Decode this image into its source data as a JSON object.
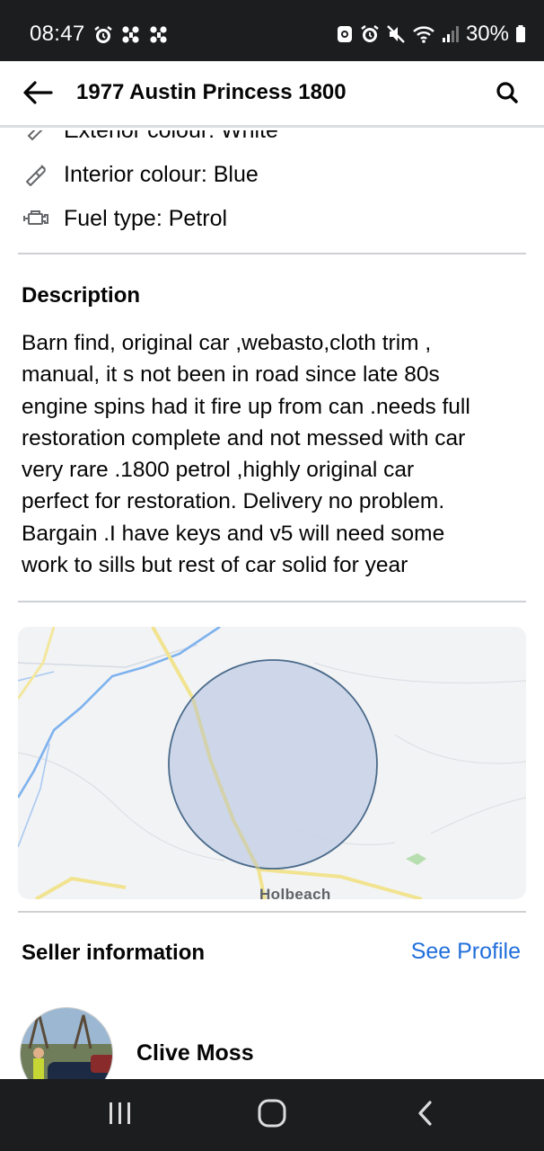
{
  "status_bar": {
    "time": "08:47",
    "battery": "30%",
    "left_icons": [
      "alarm-icon",
      "grid-dots-icon",
      "grid-dots-icon"
    ],
    "right_icons": [
      "lock-icon",
      "alarm-icon",
      "mute-icon",
      "wifi-icon",
      "signal-icon",
      "battery-icon"
    ]
  },
  "header": {
    "title": "1977 Austin Princess 1800"
  },
  "specs": [
    {
      "icon": "paint-icon",
      "label": "Exterior colour: White"
    },
    {
      "icon": "paint-icon",
      "label": "Interior colour: Blue"
    },
    {
      "icon": "engine-icon",
      "label": "Fuel type: Petrol"
    }
  ],
  "description": {
    "heading": "Description",
    "text": "Barn find, original car ,webasto,cloth trim ,\nmanual, it s not been in road since late 80s\nengine spins had it fire up from can .needs full\nrestoration  complete and not messed with car\nvery rare .1800 petrol ,highly original  car\nperfect for restoration. Delivery no problem.\nBargain .I have keys and v5 will need some\nwork to sills but rest of car solid for year"
  },
  "map": {
    "place_label": "Holbeach"
  },
  "seller": {
    "heading": "Seller information",
    "see_profile": "See Profile",
    "name": "Clive Moss"
  },
  "colors": {
    "status_bar_bg": "#1c1d1f",
    "link": "#216fdb",
    "divider": "#ced0d4",
    "map_circle_fill": "#c9d4e8",
    "map_circle_stroke": "#4a6a8a"
  }
}
